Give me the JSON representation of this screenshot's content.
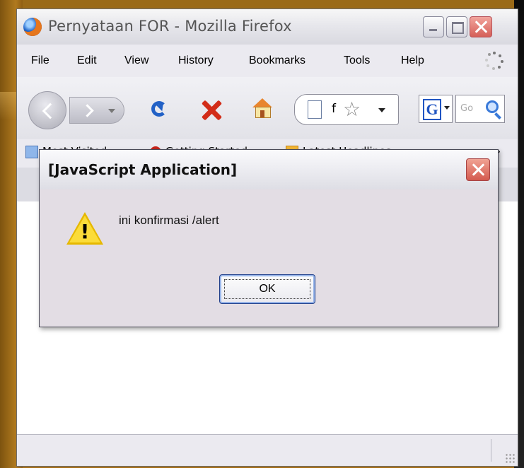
{
  "window": {
    "title": "Pernyataan FOR - Mozilla Firefox"
  },
  "menubar": {
    "items": [
      {
        "label": "File"
      },
      {
        "label": "Edit"
      },
      {
        "label": "View"
      },
      {
        "label": "History"
      },
      {
        "label": "Bookmarks"
      },
      {
        "label": "Tools"
      },
      {
        "label": "Help"
      }
    ]
  },
  "navbar": {
    "url_text": "f",
    "search_placeholder": "Go"
  },
  "bookmarks": {
    "items": [
      {
        "label": "Most Visited"
      },
      {
        "label": "Getting Started"
      },
      {
        "label": "Latest Headlines"
      }
    ],
    "overflow": "»"
  },
  "alert": {
    "title": "[JavaScript Application]",
    "message": "ini konfirmasi /alert",
    "ok_label": "OK"
  },
  "colors": {
    "desktop_bg": "#b37c1f",
    "alert_body": "#e3dde4",
    "close_button": "#d45a4f"
  },
  "icons": {
    "browser_logo": "firefox-logo-icon",
    "warning": "warning-icon"
  }
}
